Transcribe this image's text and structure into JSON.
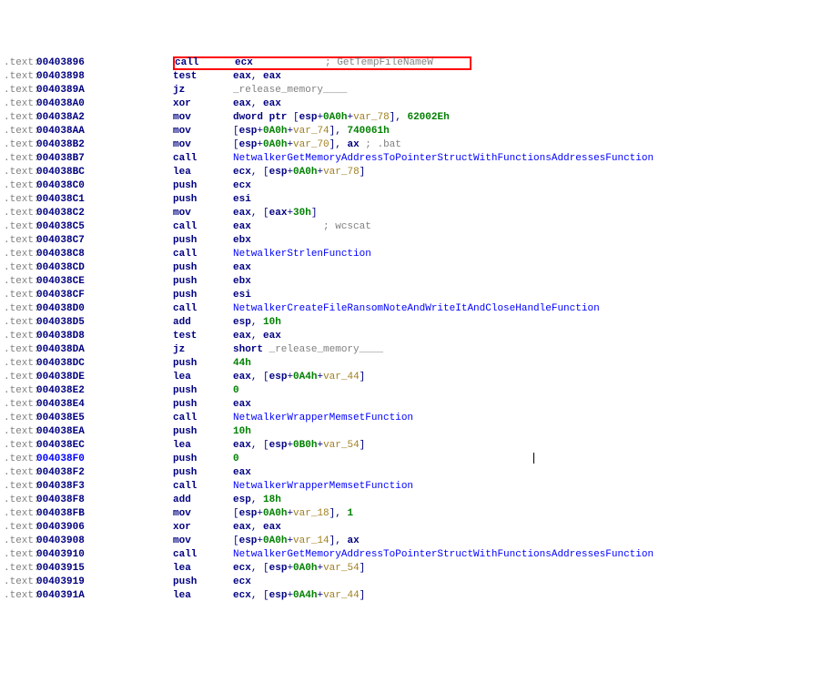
{
  "lines": [
    {
      "addr": "00403896",
      "mne": "call",
      "highlight": true,
      "ops": [
        {
          "t": "reg",
          "v": "ecx"
        }
      ],
      "pad": "            ",
      "cmt": "; GetTempFileNameW"
    },
    {
      "addr": "00403898",
      "mne": "test",
      "ops": [
        {
          "t": "reg",
          "v": "eax"
        },
        {
          "t": "plain",
          "v": ", "
        },
        {
          "t": "reg",
          "v": "eax"
        }
      ]
    },
    {
      "addr": "0040389A",
      "mne": "jz",
      "ops": [
        {
          "t": "label",
          "v": "_release_memory____"
        }
      ]
    },
    {
      "addr": "004038A0",
      "mne": "xor",
      "ops": [
        {
          "t": "reg",
          "v": "eax"
        },
        {
          "t": "plain",
          "v": ", "
        },
        {
          "t": "reg",
          "v": "eax"
        }
      ]
    },
    {
      "addr": "004038A2",
      "mne": "mov",
      "ops": [
        {
          "t": "reg",
          "v": "dword ptr "
        },
        {
          "t": "plain",
          "v": "["
        },
        {
          "t": "reg",
          "v": "esp"
        },
        {
          "t": "plain",
          "v": "+"
        },
        {
          "t": "num",
          "v": "0A0h"
        },
        {
          "t": "plain",
          "v": "+"
        },
        {
          "t": "var",
          "v": "var_78"
        },
        {
          "t": "plain",
          "v": "], "
        },
        {
          "t": "num",
          "v": "62002Eh"
        }
      ]
    },
    {
      "addr": "004038AA",
      "mne": "mov",
      "ops": [
        {
          "t": "plain",
          "v": "["
        },
        {
          "t": "reg",
          "v": "esp"
        },
        {
          "t": "plain",
          "v": "+"
        },
        {
          "t": "num",
          "v": "0A0h"
        },
        {
          "t": "plain",
          "v": "+"
        },
        {
          "t": "var",
          "v": "var_74"
        },
        {
          "t": "plain",
          "v": "], "
        },
        {
          "t": "num",
          "v": "740061h"
        }
      ]
    },
    {
      "addr": "004038B2",
      "mne": "mov",
      "ops": [
        {
          "t": "plain",
          "v": "["
        },
        {
          "t": "reg",
          "v": "esp"
        },
        {
          "t": "plain",
          "v": "+"
        },
        {
          "t": "num",
          "v": "0A0h"
        },
        {
          "t": "plain",
          "v": "+"
        },
        {
          "t": "var",
          "v": "var_70"
        },
        {
          "t": "plain",
          "v": "], "
        },
        {
          "t": "reg",
          "v": "ax "
        },
        {
          "t": "comment",
          "v": "; .bat"
        }
      ]
    },
    {
      "addr": "004038B7",
      "mne": "call",
      "ops": [
        {
          "t": "func",
          "v": "NetwalkerGetMemoryAddressToPointerStructWithFunctionsAddressesFunction"
        }
      ]
    },
    {
      "addr": "004038BC",
      "mne": "lea",
      "ops": [
        {
          "t": "reg",
          "v": "ecx"
        },
        {
          "t": "plain",
          "v": ", ["
        },
        {
          "t": "reg",
          "v": "esp"
        },
        {
          "t": "plain",
          "v": "+"
        },
        {
          "t": "num",
          "v": "0A0h"
        },
        {
          "t": "plain",
          "v": "+"
        },
        {
          "t": "var",
          "v": "var_78"
        },
        {
          "t": "plain",
          "v": "]"
        }
      ]
    },
    {
      "addr": "004038C0",
      "mne": "push",
      "ops": [
        {
          "t": "reg",
          "v": "ecx"
        }
      ]
    },
    {
      "addr": "004038C1",
      "mne": "push",
      "ops": [
        {
          "t": "reg",
          "v": "esi"
        }
      ]
    },
    {
      "addr": "004038C2",
      "mne": "mov",
      "ops": [
        {
          "t": "reg",
          "v": "eax"
        },
        {
          "t": "plain",
          "v": ", ["
        },
        {
          "t": "reg",
          "v": "eax"
        },
        {
          "t": "plain",
          "v": "+"
        },
        {
          "t": "num",
          "v": "30h"
        },
        {
          "t": "plain",
          "v": "]"
        }
      ]
    },
    {
      "addr": "004038C5",
      "mne": "call",
      "ops": [
        {
          "t": "reg",
          "v": "eax"
        }
      ],
      "pad": "            ",
      "cmt": "; wcscat"
    },
    {
      "addr": "004038C7",
      "mne": "push",
      "ops": [
        {
          "t": "reg",
          "v": "ebx"
        }
      ]
    },
    {
      "addr": "004038C8",
      "mne": "call",
      "ops": [
        {
          "t": "func",
          "v": "NetwalkerStrlenFunction"
        }
      ]
    },
    {
      "addr": "004038CD",
      "mne": "push",
      "ops": [
        {
          "t": "reg",
          "v": "eax"
        }
      ]
    },
    {
      "addr": "004038CE",
      "mne": "push",
      "ops": [
        {
          "t": "reg",
          "v": "ebx"
        }
      ]
    },
    {
      "addr": "004038CF",
      "mne": "push",
      "ops": [
        {
          "t": "reg",
          "v": "esi"
        }
      ]
    },
    {
      "addr": "004038D0",
      "mne": "call",
      "ops": [
        {
          "t": "func",
          "v": "NetwalkerCreateFileRansomNoteAndWriteItAndCloseHandleFunction"
        }
      ]
    },
    {
      "addr": "004038D5",
      "mne": "add",
      "ops": [
        {
          "t": "reg",
          "v": "esp"
        },
        {
          "t": "plain",
          "v": ", "
        },
        {
          "t": "num",
          "v": "10h"
        }
      ]
    },
    {
      "addr": "004038D8",
      "mne": "test",
      "ops": [
        {
          "t": "reg",
          "v": "eax"
        },
        {
          "t": "plain",
          "v": ", "
        },
        {
          "t": "reg",
          "v": "eax"
        }
      ]
    },
    {
      "addr": "004038DA",
      "mne": "jz",
      "ops": [
        {
          "t": "reg",
          "v": "short "
        },
        {
          "t": "label",
          "v": "_release_memory____"
        }
      ]
    },
    {
      "addr": "004038DC",
      "mne": "push",
      "ops": [
        {
          "t": "num",
          "v": "44h"
        }
      ]
    },
    {
      "addr": "004038DE",
      "mne": "lea",
      "ops": [
        {
          "t": "reg",
          "v": "eax"
        },
        {
          "t": "plain",
          "v": ", ["
        },
        {
          "t": "reg",
          "v": "esp"
        },
        {
          "t": "plain",
          "v": "+"
        },
        {
          "t": "num",
          "v": "0A4h"
        },
        {
          "t": "plain",
          "v": "+"
        },
        {
          "t": "var",
          "v": "var_44"
        },
        {
          "t": "plain",
          "v": "]"
        }
      ]
    },
    {
      "addr": "004038E2",
      "mne": "push",
      "ops": [
        {
          "t": "num",
          "v": "0"
        }
      ]
    },
    {
      "addr": "004038E4",
      "mne": "push",
      "ops": [
        {
          "t": "reg",
          "v": "eax"
        }
      ]
    },
    {
      "addr": "004038E5",
      "mne": "call",
      "ops": [
        {
          "t": "func",
          "v": "NetwalkerWrapperMemsetFunction"
        }
      ]
    },
    {
      "addr": "004038EA",
      "mne": "push",
      "ops": [
        {
          "t": "num",
          "v": "10h"
        }
      ]
    },
    {
      "addr": "004038EC",
      "mne": "lea",
      "ops": [
        {
          "t": "reg",
          "v": "eax"
        },
        {
          "t": "plain",
          "v": ", ["
        },
        {
          "t": "reg",
          "v": "esp"
        },
        {
          "t": "plain",
          "v": "+"
        },
        {
          "t": "num",
          "v": "0B0h"
        },
        {
          "t": "plain",
          "v": "+"
        },
        {
          "t": "var",
          "v": "var_54"
        },
        {
          "t": "plain",
          "v": "]"
        }
      ]
    },
    {
      "addr": "004038F0",
      "mne": "push",
      "ops": [
        {
          "t": "num",
          "v": "0"
        }
      ],
      "selcursor": true
    },
    {
      "addr": "004038F2",
      "mne": "push",
      "ops": [
        {
          "t": "reg",
          "v": "eax"
        }
      ]
    },
    {
      "addr": "004038F3",
      "mne": "call",
      "ops": [
        {
          "t": "func",
          "v": "NetwalkerWrapperMemsetFunction"
        }
      ]
    },
    {
      "addr": "004038F8",
      "mne": "add",
      "ops": [
        {
          "t": "reg",
          "v": "esp"
        },
        {
          "t": "plain",
          "v": ", "
        },
        {
          "t": "num",
          "v": "18h"
        }
      ]
    },
    {
      "addr": "004038FB",
      "mne": "mov",
      "ops": [
        {
          "t": "plain",
          "v": "["
        },
        {
          "t": "reg",
          "v": "esp"
        },
        {
          "t": "plain",
          "v": "+"
        },
        {
          "t": "num",
          "v": "0A0h"
        },
        {
          "t": "plain",
          "v": "+"
        },
        {
          "t": "var",
          "v": "var_18"
        },
        {
          "t": "plain",
          "v": "], "
        },
        {
          "t": "num",
          "v": "1"
        }
      ]
    },
    {
      "addr": "00403906",
      "mne": "xor",
      "ops": [
        {
          "t": "reg",
          "v": "eax"
        },
        {
          "t": "plain",
          "v": ", "
        },
        {
          "t": "reg",
          "v": "eax"
        }
      ]
    },
    {
      "addr": "00403908",
      "mne": "mov",
      "ops": [
        {
          "t": "plain",
          "v": "["
        },
        {
          "t": "reg",
          "v": "esp"
        },
        {
          "t": "plain",
          "v": "+"
        },
        {
          "t": "num",
          "v": "0A0h"
        },
        {
          "t": "plain",
          "v": "+"
        },
        {
          "t": "var",
          "v": "var_14"
        },
        {
          "t": "plain",
          "v": "], "
        },
        {
          "t": "reg",
          "v": "ax"
        }
      ]
    },
    {
      "addr": "00403910",
      "mne": "call",
      "ops": [
        {
          "t": "func",
          "v": "NetwalkerGetMemoryAddressToPointerStructWithFunctionsAddressesFunction"
        }
      ]
    },
    {
      "addr": "00403915",
      "mne": "lea",
      "ops": [
        {
          "t": "reg",
          "v": "ecx"
        },
        {
          "t": "plain",
          "v": ", ["
        },
        {
          "t": "reg",
          "v": "esp"
        },
        {
          "t": "plain",
          "v": "+"
        },
        {
          "t": "num",
          "v": "0A0h"
        },
        {
          "t": "plain",
          "v": "+"
        },
        {
          "t": "var",
          "v": "var_54"
        },
        {
          "t": "plain",
          "v": "]"
        }
      ]
    },
    {
      "addr": "00403919",
      "mne": "push",
      "ops": [
        {
          "t": "reg",
          "v": "ecx"
        }
      ]
    },
    {
      "addr": "0040391A",
      "mne": "lea",
      "ops": [
        {
          "t": "reg",
          "v": "ecx"
        },
        {
          "t": "plain",
          "v": ", ["
        },
        {
          "t": "reg",
          "v": "esp"
        },
        {
          "t": "plain",
          "v": "+"
        },
        {
          "t": "num",
          "v": "0A4h"
        },
        {
          "t": "plain",
          "v": "+"
        },
        {
          "t": "var",
          "v": "var_44"
        },
        {
          "t": "plain",
          "v": "]"
        }
      ]
    }
  ],
  "addr_prefix": ".text:",
  "cursor_pad": "                                                 "
}
